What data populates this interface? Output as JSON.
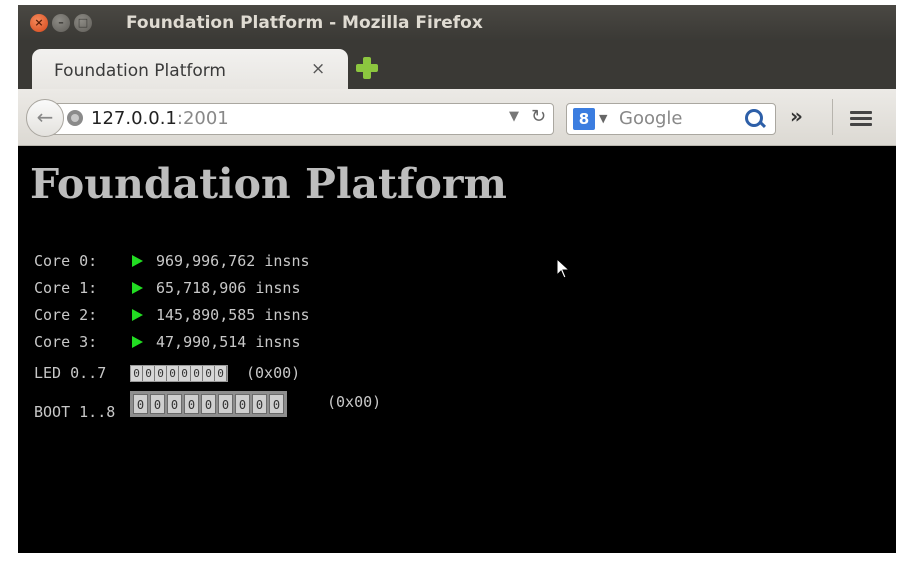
{
  "window": {
    "title": "Foundation Platform - Mozilla Firefox"
  },
  "tabs": [
    {
      "label": "Foundation Platform",
      "close": "×"
    }
  ],
  "navbar": {
    "url_host": "127.0.0.1",
    "url_port": ":2001",
    "search_placeholder": "Google",
    "overflow": "»"
  },
  "page": {
    "title": "Foundation Platform",
    "cores": [
      {
        "label": "Core 0:",
        "count": "969,996,762 insns"
      },
      {
        "label": "Core 1:",
        "count": "65,718,906 insns"
      },
      {
        "label": "Core 2:",
        "count": "145,890,585 insns"
      },
      {
        "label": "Core 3:",
        "count": "47,990,514 insns"
      }
    ],
    "led": {
      "label": "LED 0..7",
      "cells": [
        "0",
        "0",
        "0",
        "0",
        "0",
        "0",
        "0",
        "0"
      ],
      "hex": "(0x00)"
    },
    "boot": {
      "label": "BOOT 1..8",
      "cells": [
        "0",
        "0",
        "0",
        "0",
        "0",
        "0",
        "0",
        "0",
        "0"
      ],
      "hex": "(0x00)"
    },
    "status_color": "#22dd22"
  }
}
